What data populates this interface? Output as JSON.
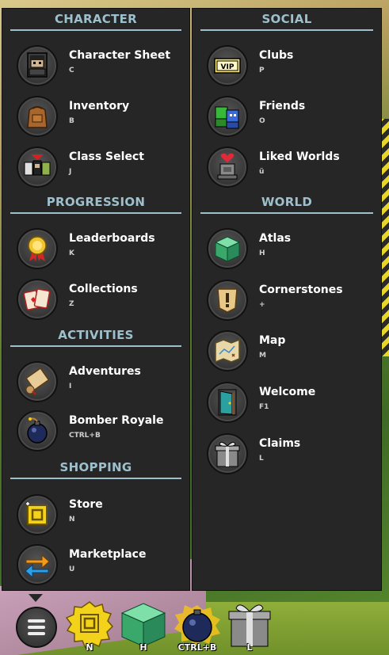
{
  "colors": {
    "panel": "#262626",
    "section": "#9ec0cc",
    "label": "#ffffff"
  },
  "left": {
    "sections": [
      {
        "title": "CHARACTER",
        "items": [
          {
            "label": "Character Sheet",
            "key": "C",
            "icon": "character-sheet-icon"
          },
          {
            "label": "Inventory",
            "key": "B",
            "icon": "backpack-icon"
          },
          {
            "label": "Class Select",
            "key": "J",
            "icon": "class-select-icon"
          }
        ]
      },
      {
        "title": "PROGRESSION",
        "items": [
          {
            "label": "Leaderboards",
            "key": "K",
            "icon": "medal-icon"
          },
          {
            "label": "Collections",
            "key": "Z",
            "icon": "cards-icon"
          }
        ]
      },
      {
        "title": "ACTIVITIES",
        "items": [
          {
            "label": "Adventures",
            "key": "I",
            "icon": "scroll-icon"
          },
          {
            "label": "Bomber Royale",
            "key": "CTRL+B",
            "icon": "bomb-icon"
          }
        ]
      },
      {
        "title": "SHOPPING",
        "items": [
          {
            "label": "Store",
            "key": "N",
            "icon": "store-icon"
          },
          {
            "label": "Marketplace",
            "key": "U",
            "icon": "exchange-arrows-icon"
          }
        ]
      }
    ]
  },
  "right": {
    "sections": [
      {
        "title": "SOCIAL",
        "items": [
          {
            "label": "Clubs",
            "key": "P",
            "icon": "vip-ticket-icon"
          },
          {
            "label": "Friends",
            "key": "O",
            "icon": "friends-icon"
          },
          {
            "label": "Liked Worlds",
            "key": "ü",
            "icon": "heart-shrine-icon"
          }
        ]
      },
      {
        "title": "WORLD",
        "items": [
          {
            "label": "Atlas",
            "key": "H",
            "icon": "atlas-cube-icon"
          },
          {
            "label": "Cornerstones",
            "key": "+",
            "icon": "cornerstone-icon"
          },
          {
            "label": "Map",
            "key": "M",
            "icon": "map-icon"
          },
          {
            "label": "Welcome",
            "key": "F1",
            "icon": "door-icon"
          },
          {
            "label": "Claims",
            "key": "L",
            "icon": "gift-box-icon"
          }
        ]
      }
    ]
  },
  "hotbar": [
    {
      "key": "N",
      "icon": "store-icon"
    },
    {
      "key": "H",
      "icon": "atlas-cube-icon"
    },
    {
      "key": "CTRL+B",
      "icon": "bomb-icon"
    },
    {
      "key": "L",
      "icon": "gift-box-icon"
    }
  ]
}
